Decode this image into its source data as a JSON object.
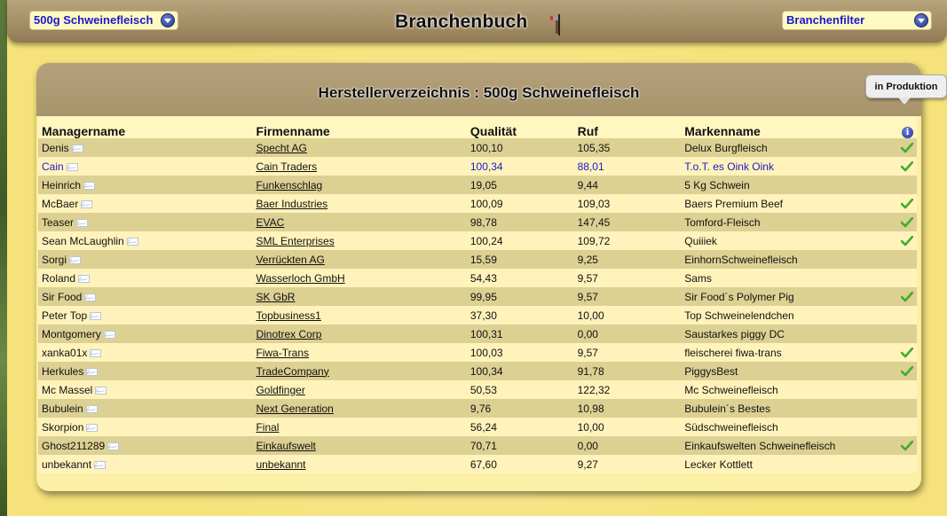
{
  "header": {
    "title": "Branchenbuch",
    "product_select": "500g Schweinefleisch",
    "filter_select": "Branchenfilter"
  },
  "panel": {
    "title": "Herstellerverzeichnis : 500g Schweinefleisch",
    "tooltip": "in Produktion"
  },
  "table": {
    "columns": [
      "Managername",
      "Firmenname",
      "Qualität",
      "Ruf",
      "Markenname"
    ],
    "rows": [
      {
        "manager": "Denis",
        "company": "Specht AG",
        "quality": "100,10",
        "ruf": "105,35",
        "brand": "Delux Burgfleisch",
        "producing": true,
        "highlight": false
      },
      {
        "manager": "Cain",
        "company": "Cain Traders",
        "quality": "100,34",
        "ruf": "88,01",
        "brand": "T.o.T. es Oink Oink",
        "producing": true,
        "highlight": true
      },
      {
        "manager": "Heinrich",
        "company": "Funkenschlag",
        "quality": "19,05",
        "ruf": "9,44",
        "brand": "5 Kg Schwein",
        "producing": false,
        "highlight": false
      },
      {
        "manager": "McBaer",
        "company": "Baer Industries",
        "quality": "100,09",
        "ruf": "109,03",
        "brand": "Baers Premium Beef",
        "producing": true,
        "highlight": false
      },
      {
        "manager": "Teaser",
        "company": "EVAC",
        "quality": "98,78",
        "ruf": "147,45",
        "brand": "Tomford-Fleisch",
        "producing": true,
        "highlight": false
      },
      {
        "manager": "Sean McLaughlin",
        "company": "SML Enterprises",
        "quality": "100,24",
        "ruf": "109,72",
        "brand": "Quiiiek",
        "producing": true,
        "highlight": false
      },
      {
        "manager": "Sorgi",
        "company": "Verrückten AG",
        "quality": "15,59",
        "ruf": "9,25",
        "brand": "EinhornSchweinefleisch",
        "producing": false,
        "highlight": false
      },
      {
        "manager": "Roland",
        "company": "Wasserloch GmbH",
        "quality": "54,43",
        "ruf": "9,57",
        "brand": "Sams",
        "producing": false,
        "highlight": false
      },
      {
        "manager": "Sir Food",
        "company": "SK GbR",
        "quality": "99,95",
        "ruf": "9,57",
        "brand": "Sir Food´s Polymer Pig",
        "producing": true,
        "highlight": false
      },
      {
        "manager": "Peter Top",
        "company": "Topbusiness1",
        "quality": "37,30",
        "ruf": "10,00",
        "brand": "Top Schweinelendchen",
        "producing": false,
        "highlight": false
      },
      {
        "manager": "Montgomery",
        "company": "Dinotrex Corp",
        "quality": "100,31",
        "ruf": "0,00",
        "brand": "Saustarkes piggy DC",
        "producing": false,
        "highlight": false
      },
      {
        "manager": "xanka01x",
        "company": "Fiwa-Trans",
        "quality": "100,03",
        "ruf": "9,57",
        "brand": "fleischerei fiwa-trans",
        "producing": true,
        "highlight": false
      },
      {
        "manager": "Herkules",
        "company": "TradeCompany",
        "quality": "100,34",
        "ruf": "91,78",
        "brand": "PiggysBest",
        "producing": true,
        "highlight": false
      },
      {
        "manager": "Mc Massel",
        "company": "Goldfinger",
        "quality": "50,53",
        "ruf": "122,32",
        "brand": "Mc Schweinefleisch",
        "producing": false,
        "highlight": false
      },
      {
        "manager": "Bubulein",
        "company": "Next Generation",
        "quality": "9,76",
        "ruf": "10,98",
        "brand": "Bubulein´s Bestes",
        "producing": false,
        "highlight": false
      },
      {
        "manager": "Skorpion",
        "company": "Final",
        "quality": "56,24",
        "ruf": "10,00",
        "brand": "Südschweinefleisch",
        "producing": false,
        "highlight": false
      },
      {
        "manager": "Ghost211289",
        "company": "Einkaufswelt",
        "quality": "70,71",
        "ruf": "0,00",
        "brand": "Einkaufswelten Schweinefleisch",
        "producing": true,
        "highlight": false
      },
      {
        "manager": "unbekannt",
        "company": "unbekannt",
        "quality": "67,60",
        "ruf": "9,27",
        "brand": "Lecker Kottlett",
        "producing": false,
        "highlight": false
      }
    ]
  },
  "icons": {
    "mail": "envelope-icon",
    "producing": "checkmark-icon",
    "info": "info-icon",
    "dropdown": "chevron-down-icon",
    "tools": "hammer-icon"
  },
  "colors": {
    "link_blue": "#1a1acc",
    "row_dark": "#ddd093",
    "row_light": "#fff3bb",
    "header_brown": "#a8946b",
    "check_green": "#3fae2a"
  }
}
